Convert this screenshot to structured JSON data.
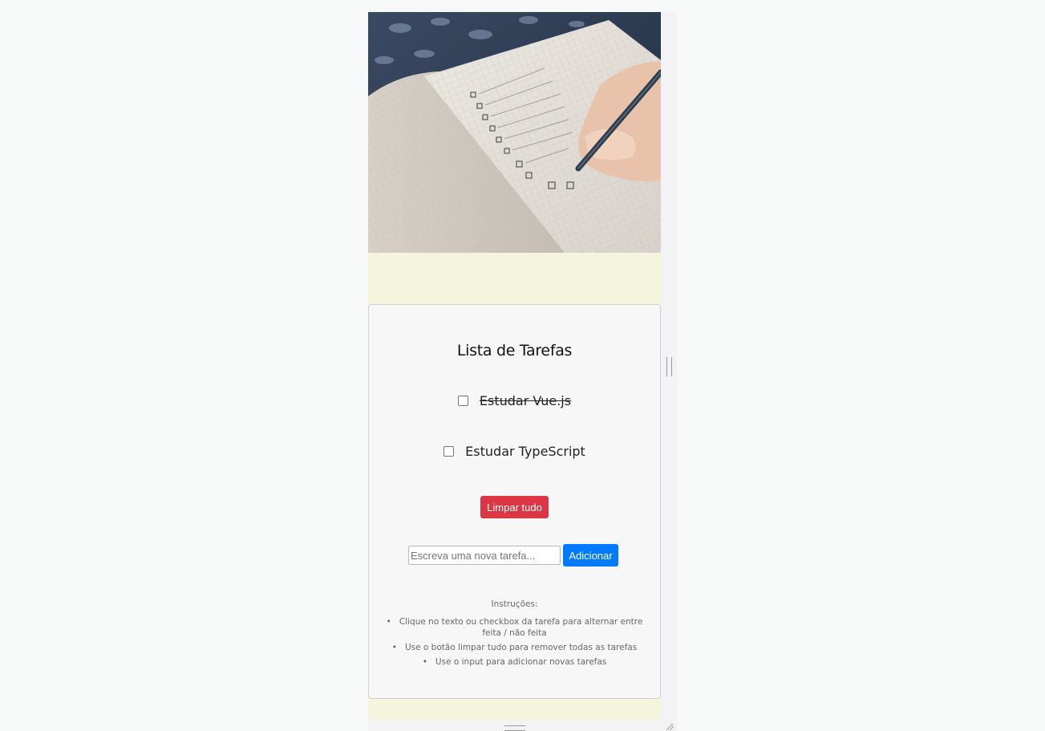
{
  "todo": {
    "title": "Lista de Tarefas",
    "tasks": [
      {
        "label": "Estudar Vue.js",
        "done": true
      },
      {
        "label": "Estudar TypeScript",
        "done": false
      }
    ],
    "clear_label": "Limpar tudo",
    "input_placeholder": "Escreva uma nova tarefa...",
    "add_label": "Adicionar"
  },
  "instructions": {
    "heading": "Instruções:",
    "items": [
      "Clique no texto ou checkbox da tarefa para alternar entre feita / não feita",
      "Use o botão limpar tudo para remover todas as tarefas",
      "Use o input para adicionar novas tarefas"
    ]
  },
  "colors": {
    "page_bg": "#f5f5de",
    "danger": "#dc3545",
    "primary": "#007bff"
  },
  "hero": {
    "icon": "notebook-checklist-photo"
  }
}
